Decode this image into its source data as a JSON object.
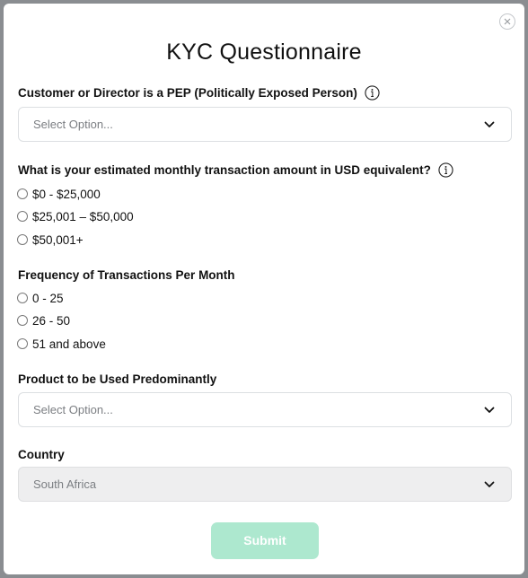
{
  "modal": {
    "title": "KYC Questionnaire",
    "close_icon": "close-icon"
  },
  "pep": {
    "label": "Customer or Director is a PEP (Politically Exposed Person)",
    "info_icon": "info-icon",
    "placeholder": "Select Option..."
  },
  "monthly_amount": {
    "label": "What is your estimated monthly transaction amount in USD equivalent?",
    "info_icon": "info-icon",
    "options": [
      "$0 - $25,000",
      "$25,001 – $50,000",
      "$50,001+"
    ]
  },
  "frequency": {
    "label": "Frequency of Transactions Per Month",
    "options": [
      "0 - 25",
      "26 - 50",
      "51 and above"
    ]
  },
  "product": {
    "label": "Product to be Used Predominantly",
    "placeholder": "Select Option..."
  },
  "country": {
    "label": "Country",
    "value": "South Africa"
  },
  "submit": {
    "label": "Submit",
    "color": "#ade8cf"
  }
}
